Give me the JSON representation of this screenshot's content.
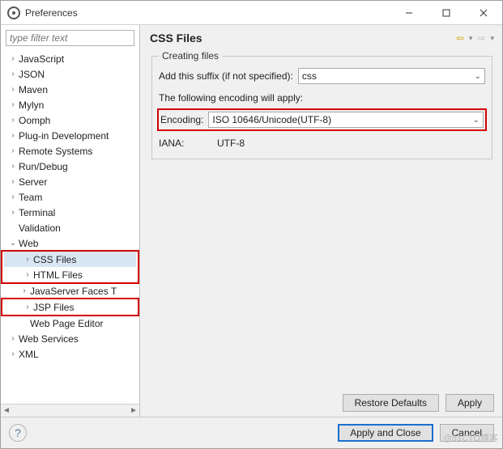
{
  "window": {
    "title": "Preferences"
  },
  "filter": {
    "placeholder": "type filter text"
  },
  "tree": {
    "items": [
      {
        "label": "JavaScript",
        "level": 0,
        "tw": ">"
      },
      {
        "label": "JSON",
        "level": 0,
        "tw": ">"
      },
      {
        "label": "Maven",
        "level": 0,
        "tw": ">"
      },
      {
        "label": "Mylyn",
        "level": 0,
        "tw": ">"
      },
      {
        "label": "Oomph",
        "level": 0,
        "tw": ">"
      },
      {
        "label": "Plug-in Development",
        "level": 0,
        "tw": ">"
      },
      {
        "label": "Remote Systems",
        "level": 0,
        "tw": ">"
      },
      {
        "label": "Run/Debug",
        "level": 0,
        "tw": ">"
      },
      {
        "label": "Server",
        "level": 0,
        "tw": ">"
      },
      {
        "label": "Team",
        "level": 0,
        "tw": ">"
      },
      {
        "label": "Terminal",
        "level": 0,
        "tw": ">"
      },
      {
        "label": "Validation",
        "level": 0,
        "tw": ""
      },
      {
        "label": "Web",
        "level": 0,
        "tw": "v"
      },
      {
        "label": "CSS Files",
        "level": 1,
        "tw": ">",
        "hl": true,
        "sel": true
      },
      {
        "label": "HTML Files",
        "level": 1,
        "tw": ">",
        "hl": true
      },
      {
        "label": "JavaServer Faces T",
        "level": 1,
        "tw": ">"
      },
      {
        "label": "JSP Files",
        "level": 1,
        "tw": ">",
        "hl2": true
      },
      {
        "label": "Web Page Editor",
        "level": 1,
        "tw": ""
      },
      {
        "label": "Web Services",
        "level": 0,
        "tw": ">"
      },
      {
        "label": "XML",
        "level": 0,
        "tw": ">"
      }
    ]
  },
  "page": {
    "heading": "CSS Files",
    "group_label": "Creating files",
    "suffix_label": "Add this suffix (if not specified):",
    "suffix_value": "css",
    "encoding_note": "The following encoding will apply:",
    "encoding_label": "Encoding:",
    "encoding_value": "ISO 10646/Unicode(UTF-8)",
    "iana_label": "IANA:",
    "iana_value": "UTF-8"
  },
  "buttons": {
    "restore": "Restore Defaults",
    "apply": "Apply",
    "apply_close": "Apply and Close",
    "cancel": "Cancel"
  },
  "watermark": "@51CTO博客"
}
